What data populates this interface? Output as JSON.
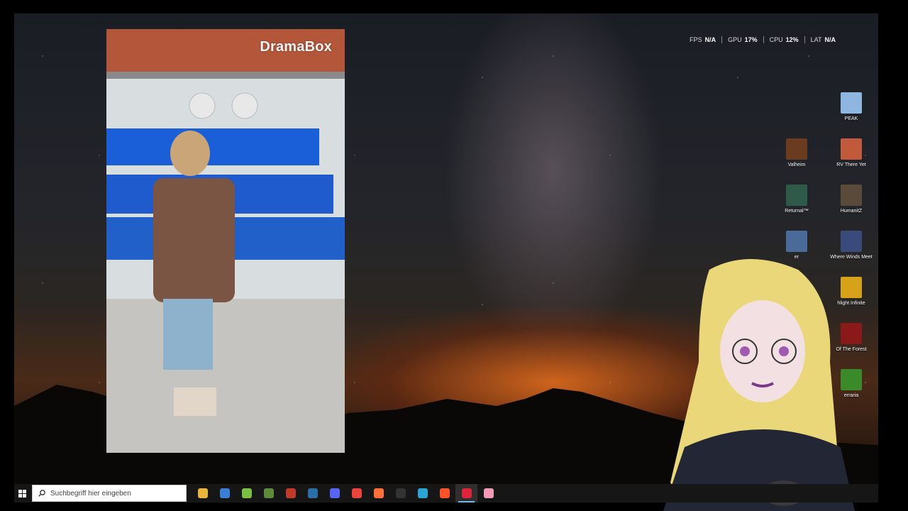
{
  "perf_overlay": [
    {
      "label": "FPS",
      "value": "N/A"
    },
    {
      "label": "GPU",
      "value": "17%"
    },
    {
      "label": "CPU",
      "value": "12%"
    },
    {
      "label": "LAT",
      "value": "N/A"
    }
  ],
  "video": {
    "brand": "DramaBox"
  },
  "desktop_icons": [
    {
      "label": "PEAK",
      "icon": "peak-icon",
      "color": "#8fb6e0"
    },
    {
      "label": "Valheim",
      "icon": "valheim-icon",
      "color": "#6a3b1f"
    },
    {
      "label": "RV There Yet",
      "icon": "rv-there-yet-icon",
      "color": "#c05a3a"
    },
    {
      "label": "Returnal™",
      "icon": "returnal-icon",
      "color": "#2f5a4a"
    },
    {
      "label": "HumanitZ",
      "icon": "humanitz-icon",
      "color": "#5a4a3a"
    },
    {
      "label": "er",
      "icon": "partial-game-icon",
      "color": "#4a6a9a"
    },
    {
      "label": "Where Winds Meet",
      "icon": "where-winds-meet-icon",
      "color": "#3a4a7a"
    },
    {
      "label": "hlight Infinite",
      "icon": "twilight-infinite-icon",
      "color": "#d6a21a"
    },
    {
      "label": "Of The Forest",
      "icon": "sons-of-the-forest-icon",
      "color": "#8a1a1a"
    },
    {
      "label": "erraria",
      "icon": "terraria-icon",
      "color": "#3a8a2a"
    }
  ],
  "taskbar": {
    "search_placeholder": "Suchbegriff hier eingeben",
    "apps": [
      {
        "icon": "file-explorer-icon",
        "color": "#e8b43a",
        "active": false
      },
      {
        "icon": "store-icon",
        "color": "#3b7fd4",
        "active": false
      },
      {
        "icon": "android-icon",
        "color": "#7bc043",
        "active": false
      },
      {
        "icon": "minecraft-icon",
        "color": "#5d8a3a",
        "active": false
      },
      {
        "icon": "razer-cortex-icon",
        "color": "#c0392b",
        "active": false
      },
      {
        "icon": "steam-icon",
        "color": "#2a6fa8",
        "active": false
      },
      {
        "icon": "discord-icon",
        "color": "#5865f2",
        "active": false
      },
      {
        "icon": "chrome-icon",
        "color": "#e8453c",
        "active": false
      },
      {
        "icon": "firefox-icon",
        "color": "#ff7139",
        "active": false
      },
      {
        "icon": "obs-icon",
        "color": "#333333",
        "active": false
      },
      {
        "icon": "sync-app-icon",
        "color": "#2aa6d6",
        "active": false
      },
      {
        "icon": "brave-icon",
        "color": "#fb542b",
        "active": false
      },
      {
        "icon": "opera-gx-icon",
        "color": "#e0243a",
        "active": true
      },
      {
        "icon": "vtuber-app-icon",
        "color": "#f29ab5",
        "active": false
      }
    ]
  }
}
